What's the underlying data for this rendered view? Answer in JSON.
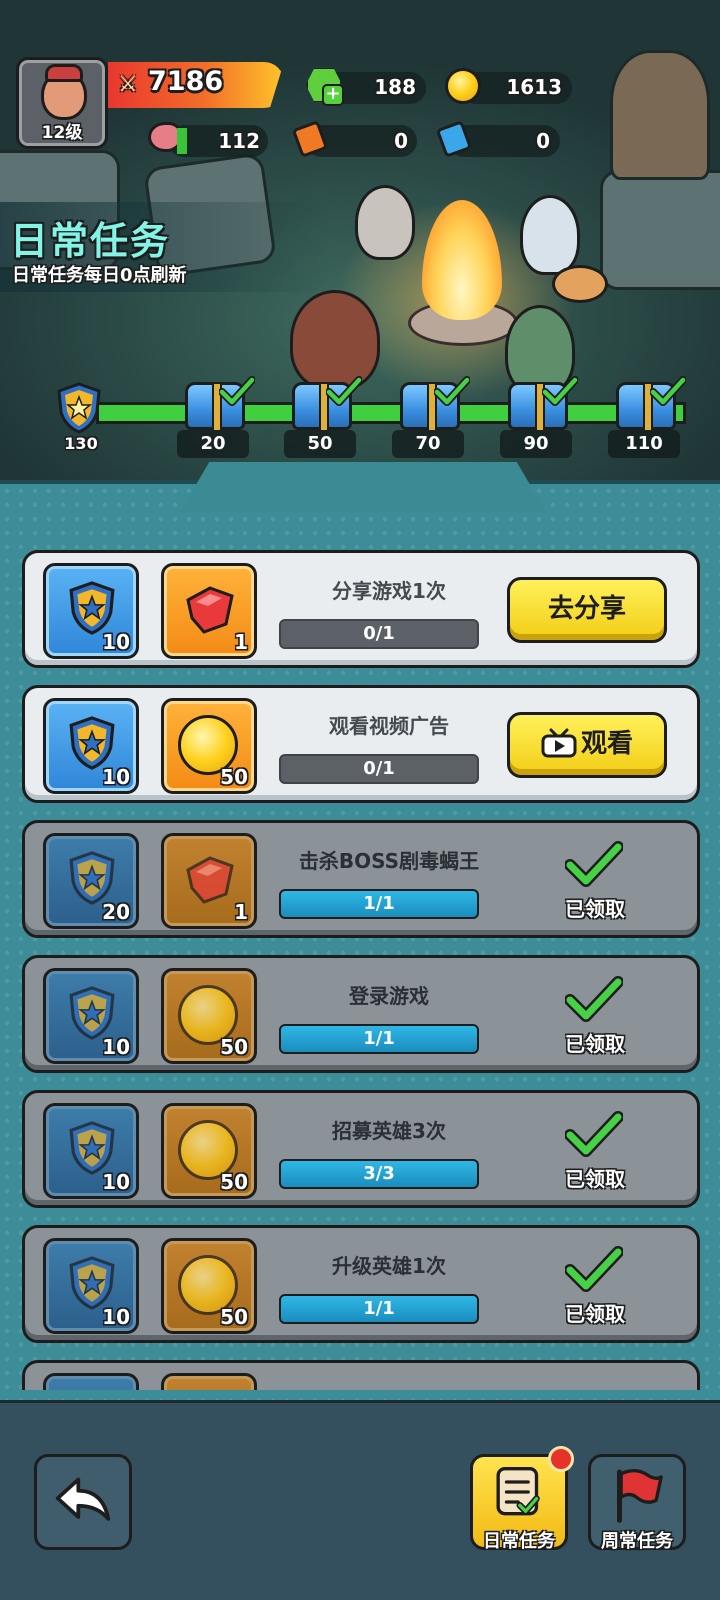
{
  "colors": {
    "accent_cyan": "#82f5e6",
    "progress_green": "#3fcf3f",
    "button_yellow": "#f2cd15",
    "claimed_bar": "#1a8dbd",
    "unclaimed_bar": "#5b6166"
  },
  "player": {
    "level_label": "12级",
    "power": "7186",
    "gems": "188",
    "coins": "1613",
    "stamina": "112",
    "ticket_orange": "0",
    "ticket_blue": "0"
  },
  "header": {
    "title": "日常任务",
    "subtitle": "日常任务每日0点刷新"
  },
  "activity": {
    "current": "130",
    "milestones": [
      "20",
      "50",
      "70",
      "90",
      "110"
    ]
  },
  "tasks": [
    {
      "name": "分享游戏1次",
      "shield": "10",
      "item_count": "1",
      "item_icon": "red-gem-icon",
      "progress": "0/1",
      "action": "去分享",
      "claimed": false
    },
    {
      "name": "观看视频广告",
      "shield": "10",
      "item_count": "50",
      "item_icon": "coin-icon",
      "progress": "0/1",
      "action": "观看",
      "action_icon": "tv-icon",
      "claimed": false
    },
    {
      "name": "击杀BOSS剧毒蝎王",
      "shield": "20",
      "item_count": "1",
      "item_icon": "red-gem-icon",
      "progress": "1/1",
      "status": "已领取",
      "claimed": true
    },
    {
      "name": "登录游戏",
      "shield": "10",
      "item_count": "50",
      "item_icon": "coin-icon",
      "progress": "1/1",
      "status": "已领取",
      "claimed": true
    },
    {
      "name": "招募英雄3次",
      "shield": "10",
      "item_count": "50",
      "item_icon": "coin-icon",
      "progress": "3/3",
      "status": "已领取",
      "claimed": true
    },
    {
      "name": "升级英雄1次",
      "shield": "10",
      "item_count": "50",
      "item_icon": "coin-icon",
      "progress": "1/1",
      "status": "已领取",
      "claimed": true
    }
  ],
  "nav": {
    "daily_label": "日常任务",
    "weekly_label": "周常任务"
  }
}
